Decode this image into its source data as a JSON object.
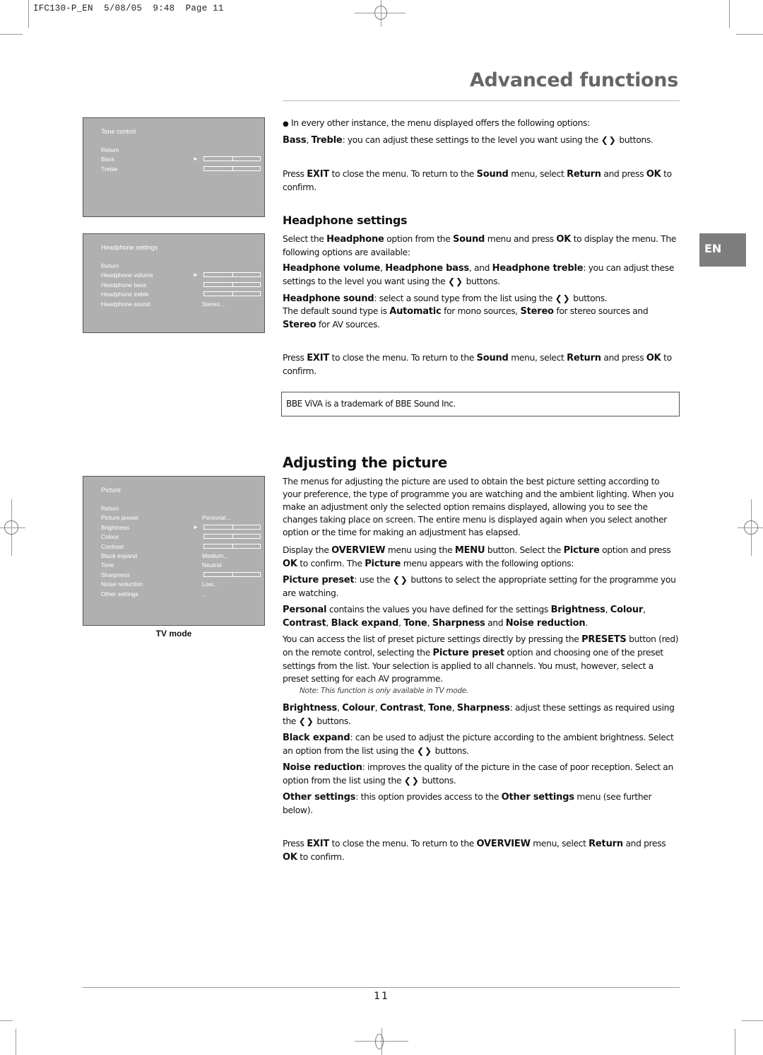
{
  "slug": "IFC130-P_EN  5/08/05  9:48  Page 11",
  "page_title": "Advanced functions",
  "language_tab": "EN",
  "page_number": "11",
  "osd_tone": {
    "title": "Tone control",
    "rows": [
      {
        "label": "Return"
      },
      {
        "label": "Bass",
        "selected": true,
        "type": "bar",
        "level": 0.5
      },
      {
        "label": "Treble",
        "type": "bar",
        "level": 0.5
      }
    ]
  },
  "osd_headphone": {
    "title": "Headphone settings",
    "rows": [
      {
        "label": "Return"
      },
      {
        "label": "Headphone volume",
        "selected": true,
        "type": "bar",
        "level": 0.5
      },
      {
        "label": "Headphone bass",
        "type": "bar",
        "level": 0.5
      },
      {
        "label": "Headphone treble",
        "type": "bar",
        "level": 0.5
      },
      {
        "label": "Headphone sound",
        "type": "value",
        "value": "Stereo..."
      }
    ]
  },
  "osd_picture": {
    "title": "Picture",
    "caption": "TV mode",
    "rows": [
      {
        "label": "Return"
      },
      {
        "label": "Picture preset",
        "type": "value",
        "value": "Personal..."
      },
      {
        "label": "Brightness",
        "selected": true,
        "type": "bar",
        "level": 0.5
      },
      {
        "label": "Colour",
        "type": "bar",
        "level": 0.5
      },
      {
        "label": "Contrast",
        "type": "bar",
        "level": 0.5
      },
      {
        "label": "Black expand",
        "type": "value",
        "value": "Medium..."
      },
      {
        "label": "Tone",
        "type": "value",
        "value": "Neutral"
      },
      {
        "label": "Sharpness",
        "type": "bar",
        "level": 0.5
      },
      {
        "label": "Noise reduction",
        "type": "value",
        "value": "Low..."
      },
      {
        "label": "Other settings",
        "type": "value",
        "value": "..."
      }
    ]
  },
  "tone_section": {
    "bullet": "In every other instance, the menu displayed offers the following options:",
    "bass_treble": {
      "b1": "Bass",
      "sep": ", ",
      "b2": "Treble",
      "rest": ": you can adjust these settings to the level you want using the",
      "arrows": "❮❯",
      "end": " buttons."
    },
    "exit": {
      "t1": "Press ",
      "b1": "EXIT",
      "t2": " to close the menu. To return to the ",
      "b2": "Sound",
      "t3": " menu, select ",
      "b3": "Return",
      "t4": " and press ",
      "b4": "OK",
      "t5": " to confirm."
    }
  },
  "headphone_section": {
    "heading": "Headphone settings",
    "intro": {
      "t1": "Select the ",
      "b1": "Headphone",
      "t2": " option from the ",
      "b2": "Sound",
      "t3": " menu and press ",
      "b3": "OK",
      "t4": " to display the menu. The following options are available:"
    },
    "levels": {
      "b1": "Headphone volume",
      "t1": ", ",
      "b2": "Headphone bass",
      "t2": ", and ",
      "b3": "Headphone treble",
      "t3": ": you can adjust these settings to the level you want using the ",
      "arrows": "❮❯",
      "t4": " buttons."
    },
    "sound": {
      "b1": "Headphone sound",
      "t1": ": select a sound type from the list using the ",
      "arrows": "❮❯",
      "t2": " buttons."
    },
    "default": {
      "t1": "The default sound type is ",
      "b1": "Automatic",
      "t2": " for mono sources, ",
      "b2": "Stereo",
      "t3": " for stereo sources and ",
      "b3": "Stereo",
      "t4": " for AV sources."
    },
    "exit": {
      "t1": "Press ",
      "b1": "EXIT",
      "t2": " to close the menu. To return to the ",
      "b2": "Sound",
      "t3": " menu, select ",
      "b3": "Return",
      "t4": " and press ",
      "b4": "OK",
      "t5": " to confirm."
    },
    "trademark": "BBE ViVA is a trademark of BBE Sound Inc."
  },
  "picture_section": {
    "heading": "Adjusting the picture",
    "intro": "The menus for adjusting the picture are used to obtain the best picture setting according to your preference, the type of programme you are watching and the ambient lighting. When you make an adjustment only the selected option remains displayed, allowing you to see the changes taking place on screen. The entire menu is displayed again when you select another option or the time for making an adjustment has elapsed.",
    "display": {
      "t1": "Display the ",
      "b1": "OVERVIEW",
      "t2": " menu using the ",
      "b2": "MENU",
      "t3": " button. Select the ",
      "b3": "Picture",
      "t4": " option and press ",
      "b4": "OK",
      "t5": " to confirm. The ",
      "b5": "Picture",
      "t6": " menu appears with the following options:"
    },
    "preset": {
      "b1": "Picture preset",
      "t1": ": use the ",
      "arrows": "❮❯",
      "t2": " buttons to select the appropriate setting for the programme you are watching."
    },
    "personal": {
      "b1": "Personal",
      "t1": " contains the values you have defined for the settings ",
      "b2": "Brightness",
      "t2": ", ",
      "b3": "Colour",
      "t3": ", ",
      "b4": "Contrast",
      "t4": ", ",
      "b5": "Black expand",
      "t5": ", ",
      "b6": "Tone",
      "t6": ", ",
      "b7": "Sharpness",
      "t7": " and ",
      "b8": "Noise reduction",
      "t8": "."
    },
    "presets_btn": {
      "t1": "You can access the list of preset picture settings directly by pressing the ",
      "b1": "PRESETS",
      "t2": " button (red) on the remote control, selecting the ",
      "b2": "Picture preset",
      "t3": " option and choosing one of the preset settings from the list. Your selection is applied to all channels. You must, however, select a preset setting for each AV programme."
    },
    "note": "Note: This function is only available in TV mode.",
    "adjust": {
      "b1": "Brightness",
      "t1": ", ",
      "b2": "Colour",
      "t2": ", ",
      "b3": "Contrast",
      "t3": ", ",
      "b4": "Tone",
      "t4": ", ",
      "b5": "Sharpness",
      "t5": ": adjust these settings as required using the ",
      "arrows": "❮❯",
      "t6": " buttons."
    },
    "black": {
      "b1": "Black expand",
      "t1": ": can be used to adjust the picture according to the ambient brightness. Select an option from the list using the ",
      "arrows": "❮❯",
      "t2": " buttons."
    },
    "noise": {
      "b1": "Noise reduction",
      "t1": ": improves the quality of the picture in the case of poor reception. Select an option from the list using the ",
      "arrows": "❮❯",
      "t2": " buttons."
    },
    "other": {
      "b1": "Other settings",
      "t1": ": this option provides access to the ",
      "b2": "Other settings",
      "t2": " menu (see further below)."
    },
    "exit": {
      "t1": "Press ",
      "b1": "EXIT",
      "t2": " to close the menu. To return to the ",
      "b2": "OVERVIEW",
      "t3": " menu, select ",
      "b3": "Return",
      "t4": " and press ",
      "b4": "OK",
      "t5": " to confirm."
    }
  }
}
